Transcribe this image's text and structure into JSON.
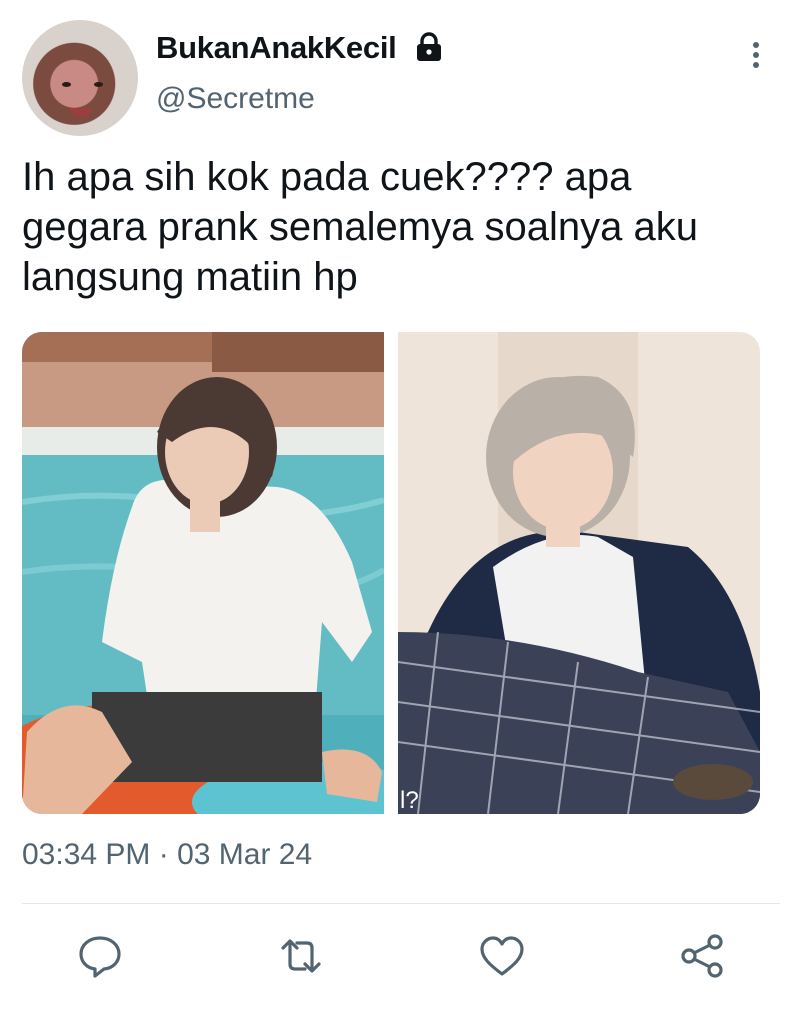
{
  "tweet": {
    "display_name": "BukanAnakKecil",
    "handle": "@Secretme",
    "protected_icon": "lock-icon",
    "text": "Ih apa sih kok pada cuek???? apa\ngegara prank semalemya soalnya aku\nlangsung matiin hp",
    "timestamp": "03:34 PM · 03 Mar 24",
    "media": [
      {
        "subject": "photo-left",
        "caption": ""
      },
      {
        "subject": "photo-right",
        "caption": "l?"
      }
    ]
  },
  "icons": {
    "more": "more-vertical-icon",
    "reply": "reply-icon",
    "retweet": "retweet-icon",
    "like": "heart-icon",
    "share": "share-icon"
  },
  "colors": {
    "text": "#0f1419",
    "secondary": "#536471",
    "divider": "#e3e7ea"
  }
}
